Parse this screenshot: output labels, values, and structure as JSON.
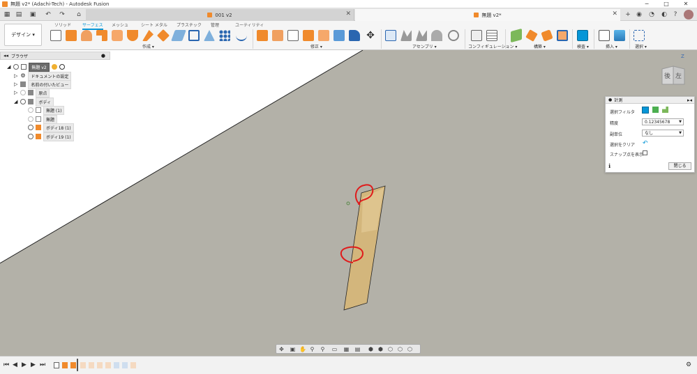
{
  "window": {
    "title": "無題 v2* (Adachi-Tech) - Autodesk Fusion",
    "min": "─",
    "max": "□",
    "close": "✕"
  },
  "tabs": [
    {
      "label": "001 v2"
    },
    {
      "label": "無題 v2*"
    }
  ],
  "ribbon": {
    "workspace": "デザイン ▾",
    "tabs": [
      "ソリッド",
      "サーフェス",
      "メッシュ",
      "シート メタル",
      "プラスチック",
      "管理",
      "ユーティリティ"
    ],
    "groups": [
      "作成 ▾",
      "修正 ▾",
      "アセンブリ ▾",
      "コンフィギュレーション ▾",
      "構築 ▾",
      "検査 ▾",
      "挿入 ▾",
      "選択 ▾"
    ]
  },
  "browser": {
    "title": "ブラウザ",
    "items": [
      {
        "label": "無題 v2"
      },
      {
        "label": "ドキュメントの設定"
      },
      {
        "label": "名前の付いたビュー"
      },
      {
        "label": "原点"
      },
      {
        "label": "ボディ"
      },
      {
        "label": "無題 (1)"
      },
      {
        "label": "無題"
      },
      {
        "label": "ボディ18 (1)"
      },
      {
        "label": "ボディ19 (1)"
      }
    ]
  },
  "viewcube": {
    "back": "後",
    "left": "左",
    "z": "Z"
  },
  "measure": {
    "title": "計測",
    "filter_label": "選択フィルタ",
    "precision_label": "精度",
    "precision_value": "0.12345678",
    "secondary_label": "副単位",
    "secondary_value": "なし",
    "clear_label": "選択をクリア",
    "snap_label": "スナップ点を表示",
    "close_label": "閉じる"
  },
  "colors": {
    "accent": "#0696d7",
    "orange": "#f08a2c",
    "viewport": "#b3b1a8",
    "plane": "#c9a86a",
    "annotation": "#e01b1b"
  }
}
